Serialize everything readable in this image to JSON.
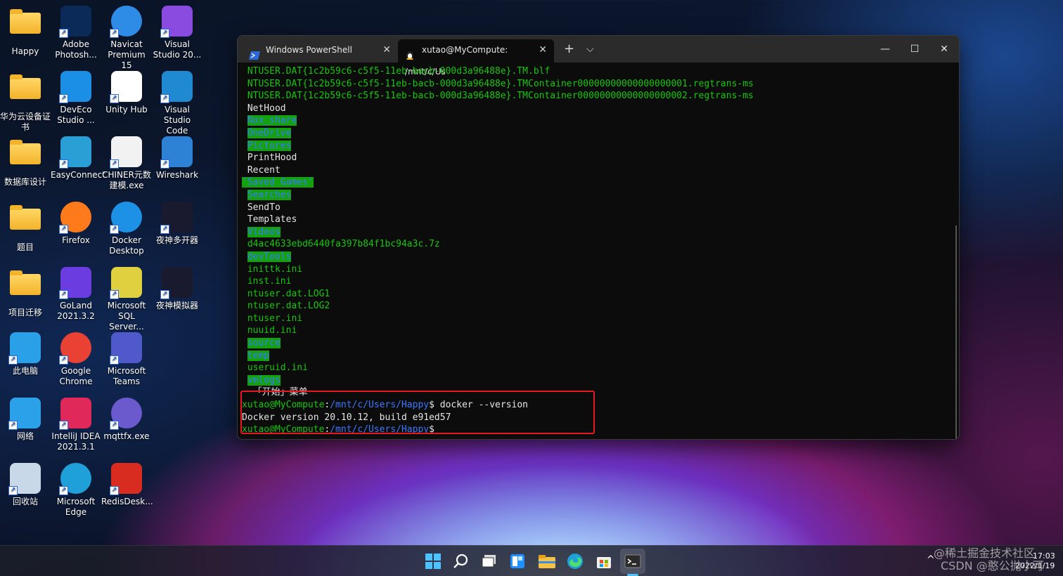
{
  "desktop_icons": [
    {
      "label": "Happy",
      "icon": "folder-icon"
    },
    {
      "label": "Adobe Photosh...",
      "icon": "photoshop-icon"
    },
    {
      "label": "Navicat Premium 15",
      "icon": "navicat-icon"
    },
    {
      "label": "Visual Studio 20...",
      "icon": "visual-studio-icon"
    },
    {
      "label": "华为云设备证书",
      "icon": "folder-icon"
    },
    {
      "label": "DevEco Studio ...",
      "icon": "deveco-icon"
    },
    {
      "label": "Unity Hub",
      "icon": "unity-icon"
    },
    {
      "label": "Visual Studio Code",
      "icon": "vscode-icon"
    },
    {
      "label": "数据库设计",
      "icon": "folder-icon"
    },
    {
      "label": "EasyConnect",
      "icon": "easyconnect-icon"
    },
    {
      "label": "CHINER元数建模.exe",
      "icon": "chiner-icon"
    },
    {
      "label": "Wireshark",
      "icon": "wireshark-icon"
    },
    {
      "label": "题目",
      "icon": "folder-icon"
    },
    {
      "label": "Firefox",
      "icon": "firefox-icon"
    },
    {
      "label": "Docker Desktop",
      "icon": "docker-icon"
    },
    {
      "label": "夜神多开器",
      "icon": "nox-icon"
    },
    {
      "label": "项目迁移",
      "icon": "folder-icon"
    },
    {
      "label": "GoLand 2021.3.2",
      "icon": "goland-icon"
    },
    {
      "label": "Microsoft SQL Server...",
      "icon": "sqlserver-icon"
    },
    {
      "label": "夜神模拟器",
      "icon": "nox-icon"
    },
    {
      "label": "此电脑",
      "icon": "computer-icon"
    },
    {
      "label": "Google Chrome",
      "icon": "chrome-icon"
    },
    {
      "label": "Microsoft Teams",
      "icon": "teams-icon"
    },
    {
      "label": "网络",
      "icon": "network-icon"
    },
    {
      "label": "IntelliJ IDEA 2021.3.1",
      "icon": "intellij-icon"
    },
    {
      "label": "mqttfx.exe",
      "icon": "mqttfx-icon"
    },
    {
      "label": "回收站",
      "icon": "recycle-bin-icon"
    },
    {
      "label": "Microsoft Edge",
      "icon": "edge-icon"
    },
    {
      "label": "RedisDesk...",
      "icon": "redis-icon"
    }
  ],
  "window": {
    "tabs": [
      {
        "label": "Windows PowerShell",
        "icon": "powershell-icon"
      },
      {
        "label": "xutao@MyCompute: /mnt/c/Us",
        "icon": "linux-icon"
      }
    ],
    "new_tab": "+",
    "dropdown": "⌵",
    "minimize": "—",
    "maximize": "☐",
    "close": "✕"
  },
  "terminal": {
    "lines": [
      {
        "text": "NTUSER.DAT{1c2b59c6-c5f5-11eb-bacb-000d3a96488e}.TM.blf",
        "type": "green"
      },
      {
        "text": "NTUSER.DAT{1c2b59c6-c5f5-11eb-bacb-000d3a96488e}.TMContainer00000000000000000001.regtrans-ms",
        "type": "green"
      },
      {
        "text": "NTUSER.DAT{1c2b59c6-c5f5-11eb-bacb-000d3a96488e}.TMContainer00000000000000000002.regtrans-ms",
        "type": "green"
      },
      {
        "text": "NetHood",
        "type": "plain"
      },
      {
        "text": "Nox_share",
        "type": "dir"
      },
      {
        "text": "OneDrive",
        "type": "dir"
      },
      {
        "text": "Pictures",
        "type": "dir"
      },
      {
        "text": "PrintHood",
        "type": "plain"
      },
      {
        "text": "Recent",
        "type": "plain"
      },
      {
        "text": "'Saved Games'",
        "type": "dir-quoted"
      },
      {
        "text": "Searches",
        "type": "dir"
      },
      {
        "text": "SendTo",
        "type": "plain"
      },
      {
        "text": "Templates",
        "type": "plain"
      },
      {
        "text": "Videos",
        "type": "dir"
      },
      {
        "text": "d4ac4633ebd6440fa397b84f1bc94a3c.7z",
        "type": "green"
      },
      {
        "text": "devTools",
        "type": "dir"
      },
      {
        "text": "inittk.ini",
        "type": "green"
      },
      {
        "text": "inst.ini",
        "type": "green"
      },
      {
        "text": "ntuser.dat.LOG1",
        "type": "green"
      },
      {
        "text": "ntuser.dat.LOG2",
        "type": "green"
      },
      {
        "text": "ntuser.ini",
        "type": "green"
      },
      {
        "text": "nuuid.ini",
        "type": "green"
      },
      {
        "text": "source",
        "type": "dir"
      },
      {
        "text": "temp",
        "type": "dir"
      },
      {
        "text": "useruid.ini",
        "type": "green"
      },
      {
        "text": "vmlogs",
        "type": "dir"
      },
      {
        "text": " 「开始」菜单",
        "type": "plain-quoted"
      }
    ],
    "prompt_user": "xutao@MyCompute",
    "prompt_path": "/mnt/c/Users/Happy",
    "command": "docker --version",
    "output": "Docker version 20.10.12, build e91ed57"
  },
  "taskbar": {
    "apps": [
      "windows-start-icon",
      "search-icon",
      "task-view-icon",
      "widgets-icon",
      "file-explorer-icon",
      "edge-icon",
      "store-icon",
      "terminal-icon"
    ],
    "tray_chevron": "^",
    "time": "17:03",
    "date": "2022/1/19"
  },
  "watermarks": [
    "@稀土掘金技术社区",
    "CSDN @憨公抛小可"
  ],
  "colors": {
    "terminal_green": "#16c60c",
    "dir_bg": "#13a10e",
    "dir_fg": "#3b78ff",
    "highlight_border": "#e8181f"
  }
}
